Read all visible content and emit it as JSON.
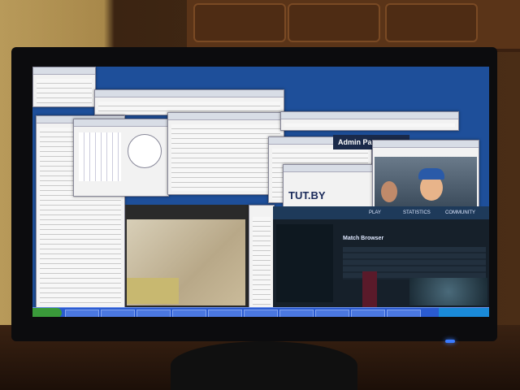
{
  "screen": {
    "tut_logo": "TUT.BY",
    "admin_title": "Admin Pane",
    "tabs": {
      "play": "PLAY",
      "statistics": "STATISTICS",
      "community": "COMMUNITY"
    },
    "match_browser": "Match Browser"
  },
  "colors": {
    "desktop": "#1e4f9a",
    "taskbar": "#2a5bd0",
    "led": "#3a7bff"
  }
}
